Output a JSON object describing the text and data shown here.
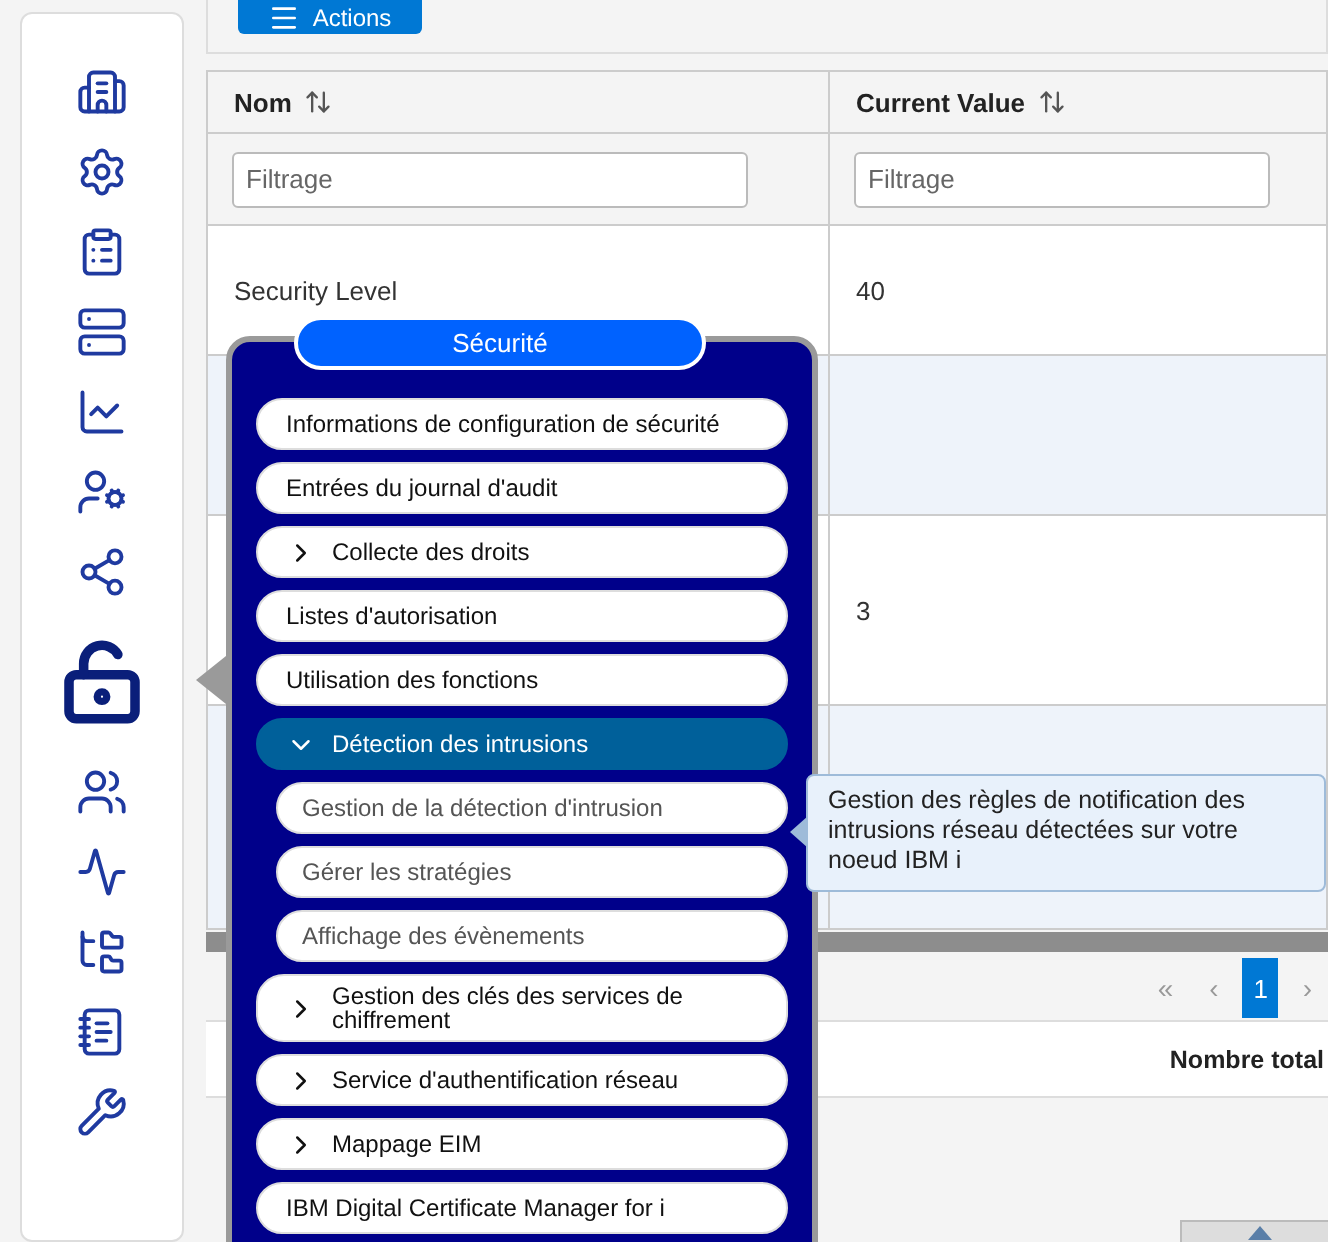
{
  "toolbar": {
    "actions_button": "Actions"
  },
  "sidebar": {
    "items": [
      {
        "selected": false
      },
      {
        "selected": false
      },
      {
        "selected": false
      },
      {
        "selected": false
      },
      {
        "selected": false
      },
      {
        "selected": false
      },
      {
        "selected": false
      },
      {
        "selected": true
      },
      {
        "selected": false
      },
      {
        "selected": false
      },
      {
        "selected": false
      },
      {
        "selected": false
      },
      {
        "selected": false
      }
    ]
  },
  "table": {
    "columns": [
      {
        "label": "Nom",
        "filter_placeholder": "Filtrage"
      },
      {
        "label": "Current Value",
        "filter_placeholder": "Filtrage"
      }
    ],
    "rows": [
      {
        "nom": "Security Level",
        "current_value": "40",
        "shaded": false
      },
      {
        "shaded": true
      },
      {
        "current_value": "3",
        "shaded": false
      },
      {
        "shaded": true
      }
    ]
  },
  "pagination": {
    "first": "«",
    "previous": "‹",
    "pages": [
      {
        "label": "1",
        "selected": true
      }
    ],
    "next": "›"
  },
  "footer": {
    "total_label": "Nombre total"
  },
  "menu": {
    "title": "Sécurité",
    "items": [
      {
        "label": "Informations de configuration de sécurité",
        "kind": "link",
        "selected": false
      },
      {
        "label": "Entrées du journal d'audit",
        "kind": "link",
        "selected": false
      },
      {
        "label": "Collecte des droits",
        "kind": "group",
        "expanded": false,
        "selected": false
      },
      {
        "label": "Listes d'autorisation",
        "kind": "link",
        "selected": false
      },
      {
        "label": "Utilisation des fonctions",
        "kind": "link",
        "selected": false
      },
      {
        "label": "Détection des intrusions",
        "kind": "group",
        "expanded": true,
        "selected": true,
        "children": [
          {
            "label": "Gestion de la détection d'intrusion",
            "kind": "link",
            "selected": false
          },
          {
            "label": "Gérer les stratégies",
            "kind": "link",
            "selected": false
          },
          {
            "label": "Affichage des évènements",
            "kind": "link",
            "selected": false
          }
        ]
      },
      {
        "label": "Gestion des clés des services de chiffrement",
        "kind": "group",
        "expanded": false,
        "selected": false
      },
      {
        "label": "Service d'authentification réseau",
        "kind": "group",
        "expanded": false,
        "selected": false
      },
      {
        "label": "Mappage EIM",
        "kind": "group",
        "expanded": false,
        "selected": false
      },
      {
        "label": "IBM Digital Certificate Manager for i",
        "kind": "link",
        "selected": false
      }
    ]
  },
  "tooltip": {
    "text": "Gestion des règles de notification des intrusions réseau détectées sur votre noeud IBM i"
  }
}
